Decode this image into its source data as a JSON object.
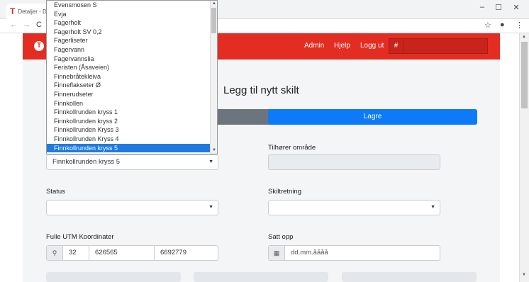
{
  "browser": {
    "tab_title": "Detaljer - D",
    "tab_favicon": "T",
    "minimize": "–",
    "maximize": "☐",
    "close": "✕",
    "back": "←",
    "forward": "→",
    "reload": "C",
    "star": "☆",
    "account": "●",
    "menu": "⋮"
  },
  "appbar": {
    "logo": "T",
    "menu": [
      "Admin",
      "Hjelp",
      "Logg ut"
    ],
    "hash_symbol": "#",
    "color": "#e32d22"
  },
  "page": {
    "title": "Legg til nytt skilt",
    "save_label": "Lagre",
    "area_label": "Tilhører område",
    "status_label": "Status",
    "direction_label": "Skiltretning",
    "utm_label": "Fulle UTM Koordinater",
    "setup_label": "Satt opp",
    "location_value": "Finnkollrunden kryss 5",
    "utm_zone": "32",
    "utm_east": "626565",
    "utm_north": "6692779",
    "date_placeholder": "dd.mm.åååå",
    "pin_icon": "map-pin-icon",
    "calendar_icon": "calendar-icon"
  },
  "dropdown": {
    "selected_index": 16,
    "options": [
      "Evensmosen S",
      "Evja",
      "Fagerholt",
      "Fagerholt SV 0,2",
      "Fagerliseter",
      "Fagervann",
      "Fagervannslia",
      "Feristen (Åsaveien)",
      "Finnebråtekleiva",
      "Finneflakseter Ø",
      "Finnerudseter",
      "Finnkollen",
      "Finnkollrunden kryss 1",
      "Finnkollrunden kryss 2",
      "Finnkollrunden Kryss 3",
      "Finnkollrunden Kryss 4",
      "Finnkollrunden kryss 5"
    ]
  }
}
